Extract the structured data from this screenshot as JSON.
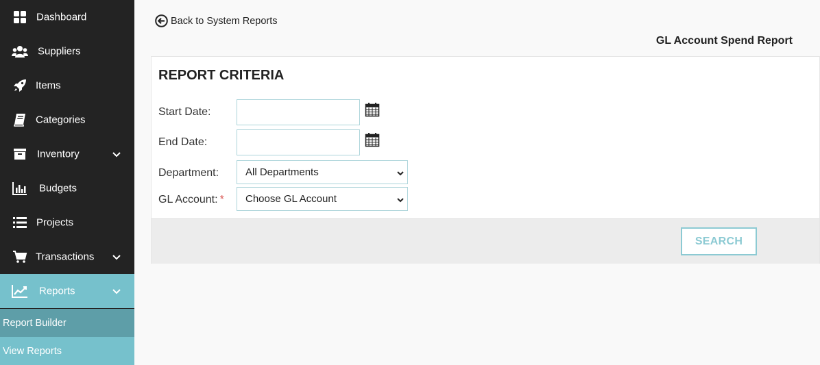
{
  "sidebar": {
    "items": [
      {
        "label": "Dashboard",
        "icon": "dashboard-icon"
      },
      {
        "label": "Suppliers",
        "icon": "users-icon"
      },
      {
        "label": "Items",
        "icon": "rocket-icon"
      },
      {
        "label": "Categories",
        "icon": "book-icon"
      },
      {
        "label": "Inventory",
        "icon": "archive-icon"
      },
      {
        "label": "Budgets",
        "icon": "bar-chart-icon"
      },
      {
        "label": "Projects",
        "icon": "list-icon"
      },
      {
        "label": "Transactions",
        "icon": "cart-icon"
      },
      {
        "label": "Reports",
        "icon": "line-chart-icon"
      }
    ],
    "subitems": [
      {
        "label": "Report Builder"
      },
      {
        "label": "View Reports"
      }
    ],
    "active_color": "#76c1cc"
  },
  "header": {
    "back_label": "Back to System Reports",
    "report_title": "GL Account Spend Report"
  },
  "criteria": {
    "heading": "REPORT CRITERIA",
    "start_date_label": "Start Date:",
    "end_date_label": "End Date:",
    "start_date_value": "",
    "end_date_value": "",
    "department_label": "Department:",
    "department_value": "All Departments",
    "gl_account_label": "GL Account:",
    "gl_account_required_mark": "*",
    "gl_account_value": "Choose GL Account",
    "search_label": "SEARCH"
  }
}
